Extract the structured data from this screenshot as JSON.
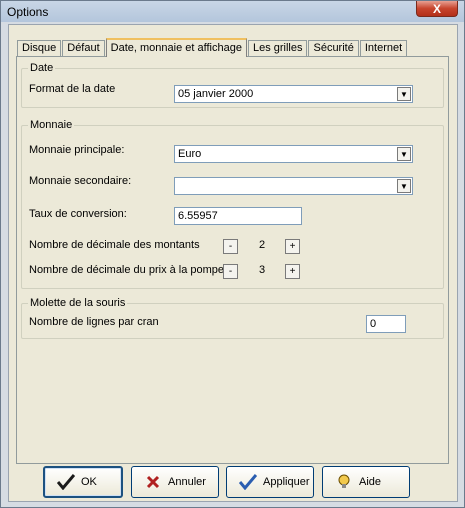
{
  "window": {
    "title": "Options",
    "close_label": "X"
  },
  "tabs": [
    {
      "label": "Disque"
    },
    {
      "label": "Défaut"
    },
    {
      "label": "Date, monnaie et affichage"
    },
    {
      "label": "Les grilles"
    },
    {
      "label": "Sécurité"
    },
    {
      "label": "Internet"
    }
  ],
  "active_tab": "Date, monnaie et affichage",
  "date_group": {
    "legend": "Date",
    "format_label": "Format de la date",
    "format_value": "05 janvier 2000"
  },
  "currency_group": {
    "legend": "Monnaie",
    "primary_label": "Monnaie principale:",
    "primary_value": "Euro",
    "secondary_label": "Monnaie secondaire:",
    "secondary_value": "",
    "rate_label": "Taux de conversion:",
    "rate_value": "6.55957",
    "amount_decimals_label": "Nombre de décimale des montants",
    "amount_decimals_value": "2",
    "pump_decimals_label": "Nombre de décimale du prix à la pompe",
    "pump_decimals_value": "3",
    "minus_label": "-",
    "plus_label": "+"
  },
  "mouse_group": {
    "legend": "Molette de la souris",
    "lines_label": "Nombre de lignes par cran",
    "lines_value": "0"
  },
  "buttons": {
    "ok": "OK",
    "cancel": "Annuler",
    "apply": "Appliquer",
    "help": "Aide"
  },
  "colors": {
    "ok_check": "#1b1b1b",
    "cancel_x": "#b02020",
    "apply_check": "#2a5db0"
  }
}
